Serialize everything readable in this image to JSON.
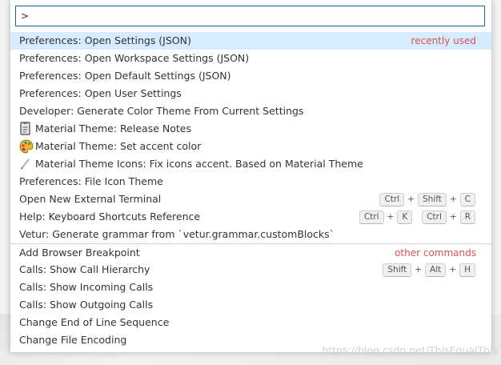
{
  "input": {
    "value": ">"
  },
  "rows": [
    {
      "label": "Preferences: Open Settings (JSON)",
      "badge": "recently used",
      "selected": true
    },
    {
      "label": "Preferences: Open Workspace Settings (JSON)"
    },
    {
      "label": "Preferences: Open Default Settings (JSON)"
    },
    {
      "label": "Preferences: Open User Settings"
    },
    {
      "label": "Developer: Generate Color Theme From Current Settings"
    },
    {
      "label": "Material Theme: Release Notes",
      "icon": "notes-icon"
    },
    {
      "label": "Material Theme: Set accent color",
      "icon": "palette-icon"
    },
    {
      "label": "Material Theme Icons: Fix icons accent. Based on Material Theme",
      "icon": "brush-icon"
    },
    {
      "label": "Preferences: File Icon Theme"
    },
    {
      "label": "Open New External Terminal",
      "keys": [
        [
          "Ctrl",
          "Shift",
          "C"
        ]
      ]
    },
    {
      "label": "Help: Keyboard Shortcuts Reference",
      "keys": [
        [
          "Ctrl",
          "K"
        ],
        [
          "Ctrl",
          "R"
        ]
      ]
    },
    {
      "label": "Vetur: Generate grammar from `vetur.grammar.customBlocks`"
    },
    {
      "label": "Add Browser Breakpoint",
      "badge": "other commands",
      "separator": true
    },
    {
      "label": "Calls: Show Call Hierarchy",
      "keys": [
        [
          "Shift",
          "Alt",
          "H"
        ]
      ]
    },
    {
      "label": "Calls: Show Incoming Calls"
    },
    {
      "label": "Calls: Show Outgoing Calls"
    },
    {
      "label": "Change End of Line Sequence"
    },
    {
      "label": "Change File Encoding"
    }
  ],
  "watermark": "https://blog.csdn.net/ThisEqualThis",
  "colors": {
    "selected_bg": "#d6ebff",
    "badge": "#d9534f",
    "input_border": "#0e639c"
  }
}
